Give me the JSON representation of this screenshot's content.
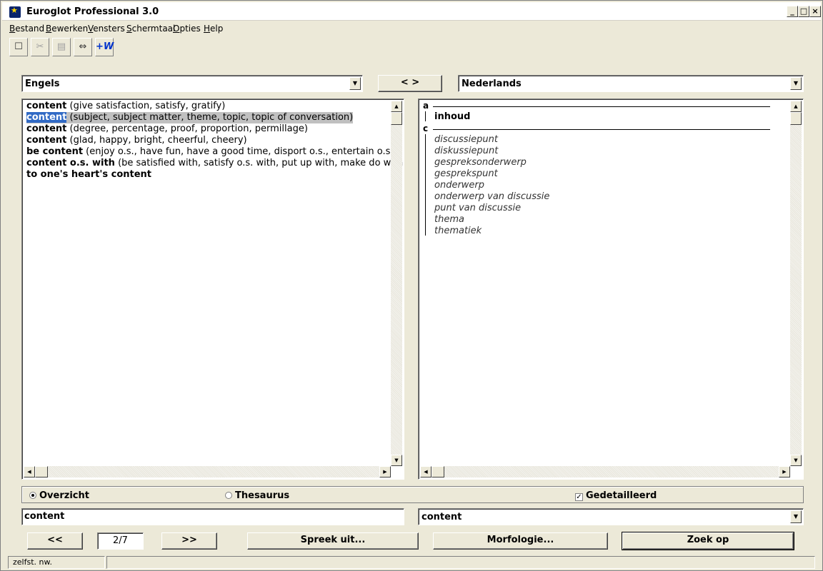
{
  "window": {
    "title": "Euroglot Professional 3.0"
  },
  "menu": [
    {
      "ul": "B",
      "rest": "estand"
    },
    {
      "ul": "B",
      "rest": "ewerken"
    },
    {
      "ul": "V",
      "rest": "ensters"
    },
    {
      "ul": "S",
      "rest": "chermtaal"
    },
    {
      "ul": "O",
      "rest": "pties"
    },
    {
      "ul": "H",
      "rest": "elp"
    }
  ],
  "toolbar": {
    "w_label": "+W"
  },
  "source_language": "Engels",
  "swap_label": "< >",
  "target_language": "Nederlands",
  "results": [
    {
      "term": "content",
      "gloss": " (give satisfaction, satisfy, gratify)"
    },
    {
      "term": "content",
      "gloss": " (subject, subject matter, theme, topic, topic of conversation)"
    },
    {
      "term": "content",
      "gloss": " (degree, percentage, proof, proportion, permillage)"
    },
    {
      "term": "content",
      "gloss": " (glad, happy, bright, cheerful, cheery)"
    },
    {
      "term": "be content",
      "gloss": " (enjoy o.s., have fun, have a good time, disport o.s., entertain o.s.)"
    },
    {
      "term": "content o.s. with",
      "gloss": " (be satisfied with, satisfy o.s. with, put up with, make do with)"
    },
    {
      "term": "to one's heart's content",
      "gloss": ""
    }
  ],
  "translation": {
    "section_a": "a",
    "main": "inhoud",
    "section_c": "c",
    "items": [
      "discussiepunt",
      "diskussiepunt",
      "gespreksonderwerp",
      "gesprekspunt",
      "onderwerp",
      "onderwerp van discussie",
      "punt van discussie",
      "thema",
      "thematiek"
    ]
  },
  "options": {
    "overzicht": "Overzicht",
    "thesaurus": "Thesaurus",
    "gedetailleerd": "Gedetailleerd"
  },
  "search_text": "content",
  "target_word": "content",
  "nav": {
    "prev": "<<",
    "page": "2/7",
    "next": ">>"
  },
  "buttons": {
    "spreek": "Spreek uit...",
    "morfologie": "Morfologie...",
    "zoek": "Zoek op"
  },
  "status": {
    "pos": "zelfst. nw."
  }
}
